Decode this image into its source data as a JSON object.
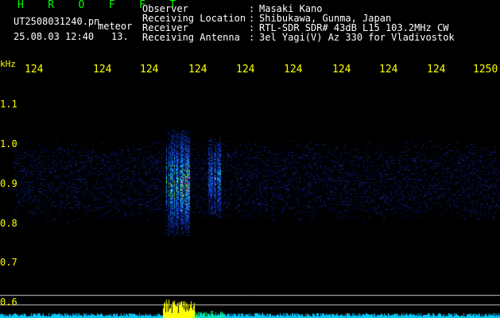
{
  "header": {
    "app_title": "H R O F F T",
    "filename": "UT2508031240.pn",
    "filename_suffix": "meteor",
    "timestamp": "25.08.03 12:40",
    "timestamp_extra": "13."
  },
  "info": [
    {
      "label": "Observer",
      "colon": ":",
      "value": "Masaki Kano"
    },
    {
      "label": "Receiving Location",
      "colon": ":",
      "value": "Shibukawa, Gunma, Japan"
    },
    {
      "label": "Receiver",
      "colon": ":",
      "value": "RTL-SDR SDR# 43dB L15 103.2MHz CW"
    },
    {
      "label": "Receiving Antenna",
      "colon": ":",
      "value": "3el Yagi(V) Az 330 for Vladivostok"
    }
  ],
  "x_axis": {
    "unit": "kHz",
    "labels": [
      "124",
      "124",
      "124",
      "124",
      "124",
      "124",
      "124",
      "124",
      "124",
      "1250"
    ]
  },
  "y_axis": {
    "labels": [
      "1.1",
      "1.0",
      "0.9",
      "0.8",
      "0.7",
      "0.6"
    ]
  },
  "colors": {
    "background": "#000000",
    "text_primary": "#ffffff",
    "accent_yellow": "#ffff00",
    "accent_green": "#00ff00",
    "baseline_cyan": "#00ffff"
  }
}
